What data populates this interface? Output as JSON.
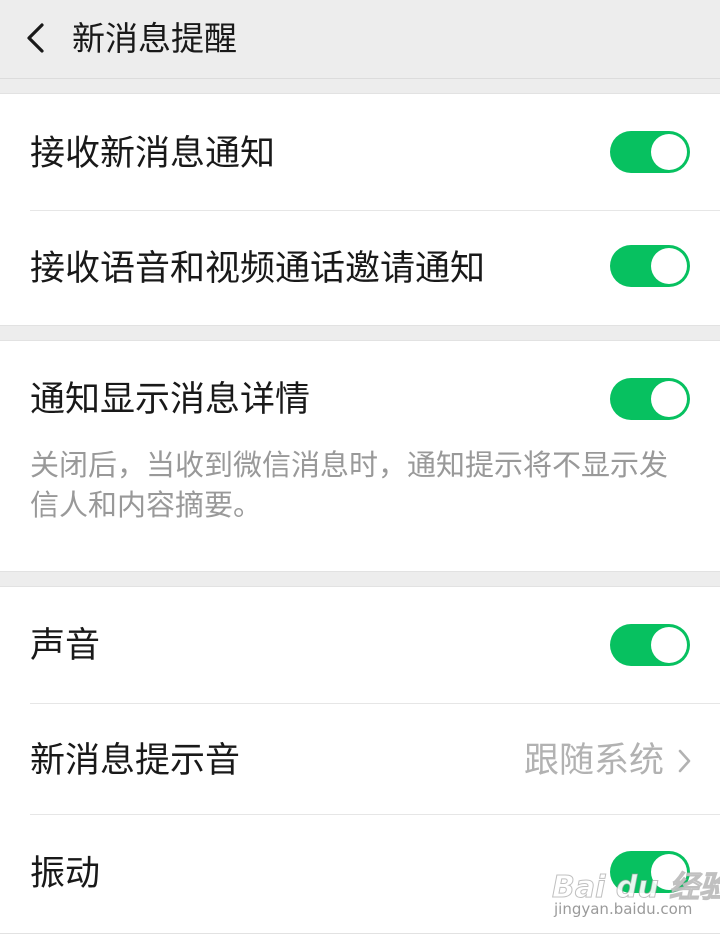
{
  "header": {
    "title": "新消息提醒",
    "back_icon": "chevron-left-icon"
  },
  "settings": {
    "receive_new_message": {
      "label": "接收新消息通知",
      "enabled": true
    },
    "receive_call_invite": {
      "label": "接收语音和视频通话邀请通知",
      "enabled": true
    },
    "show_details": {
      "label": "通知显示消息详情",
      "enabled": true,
      "description": "关闭后，当收到微信消息时，通知提示将不显示发信人和内容摘要。"
    },
    "sound": {
      "label": "声音",
      "enabled": true
    },
    "ringtone": {
      "label": "新消息提示音",
      "value": "跟随系统",
      "icon": "chevron-right-icon"
    },
    "vibrate": {
      "label": "振动",
      "enabled": true
    }
  },
  "watermark": {
    "logo_text": "Bai du 经验",
    "url_text": "jingyan.baidu.com"
  },
  "colors": {
    "toggle_on": "#07c160",
    "background": "#ededed",
    "secondary_text": "#999999"
  }
}
